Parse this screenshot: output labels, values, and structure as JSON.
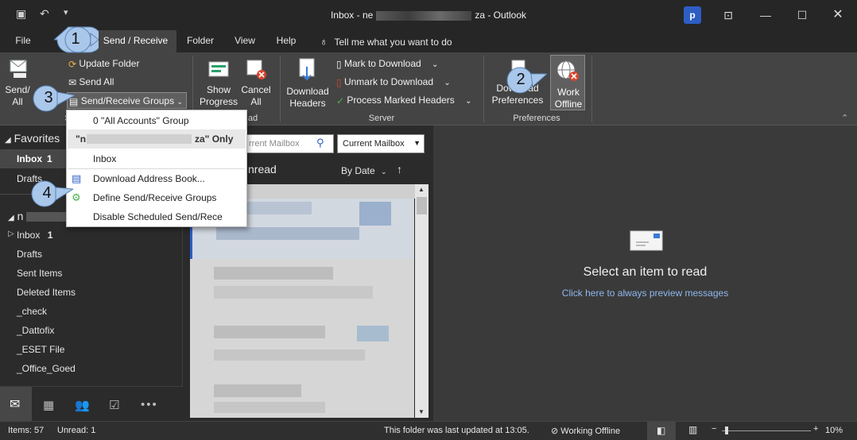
{
  "window": {
    "title_prefix": "Inbox - ne",
    "title_suffix": "za  -  Outlook"
  },
  "tabs": {
    "file": "File",
    "send_receive": "Send / Receive",
    "folder": "Folder",
    "view": "View",
    "help": "Help",
    "tell_me": "Tell me what you want to do"
  },
  "ribbon": {
    "send_all_big": "Send/ All",
    "update_folder": "Update Folder",
    "send_all": "Send All",
    "send_receive_groups": "Send/Receive Groups",
    "show_progress": "Show Progress",
    "cancel_all": "Cancel All",
    "download_headers": "Download Headers",
    "mark_to_download": "Mark to Download",
    "unmark_to_download": "Unmark to Download",
    "process_marked_headers": "Process Marked Headers",
    "download_preferences": "Download Preferences",
    "work_offline": "Work Offline",
    "group_server": "Server",
    "group_preferences": "Preferences",
    "group_download_partial": "ad",
    "group_send_partial": "S"
  },
  "dropdown": {
    "all_accounts_group": "0 \"All Accounts\" Group",
    "account_prefix": "\"n",
    "account_suffix": "za\" Only",
    "inbox": "Inbox",
    "download_address_book": "Download Address Book...",
    "define_groups": "Define Send/Receive Groups",
    "disable_scheduled": "Disable Scheduled Send/Rece"
  },
  "nav": {
    "favorites": "Favorites",
    "inbox_fav": "Inbox",
    "inbox_fav_count": "1",
    "drafts_fav": "Drafts",
    "account_partial": "n",
    "folders": [
      {
        "label": "Inbox",
        "count": "1"
      },
      {
        "label": "Drafts",
        "count": ""
      },
      {
        "label": "Sent Items",
        "count": ""
      },
      {
        "label": "Deleted Items",
        "count": ""
      },
      {
        "label": "_check",
        "count": ""
      },
      {
        "label": "_Dattofix",
        "count": ""
      },
      {
        "label": "_ESET File",
        "count": ""
      },
      {
        "label": "_Office_Goed",
        "count": ""
      }
    ]
  },
  "msglist": {
    "search_placeholder": "rrent Mailbox",
    "scope": "Current Mailbox",
    "filter_unread": "nread",
    "sort_by": "By Date",
    "sort_arrow": "↑"
  },
  "reading": {
    "empty_title": "Select an item to read",
    "preview_link": "Click here to always preview messages"
  },
  "status": {
    "items": "Items: 57",
    "unread": "Unread: 1",
    "updated": "This folder was last updated at 13:05.",
    "working_offline": "Working Offline",
    "zoom": "10%"
  },
  "callouts": {
    "c1": "1",
    "c2": "2",
    "c3": "3",
    "c4": "4"
  },
  "colors": {
    "accent": "#2d5ec4",
    "callout": "#a9c7ea",
    "titlebar": "#262626",
    "ribbon": "#444444"
  }
}
